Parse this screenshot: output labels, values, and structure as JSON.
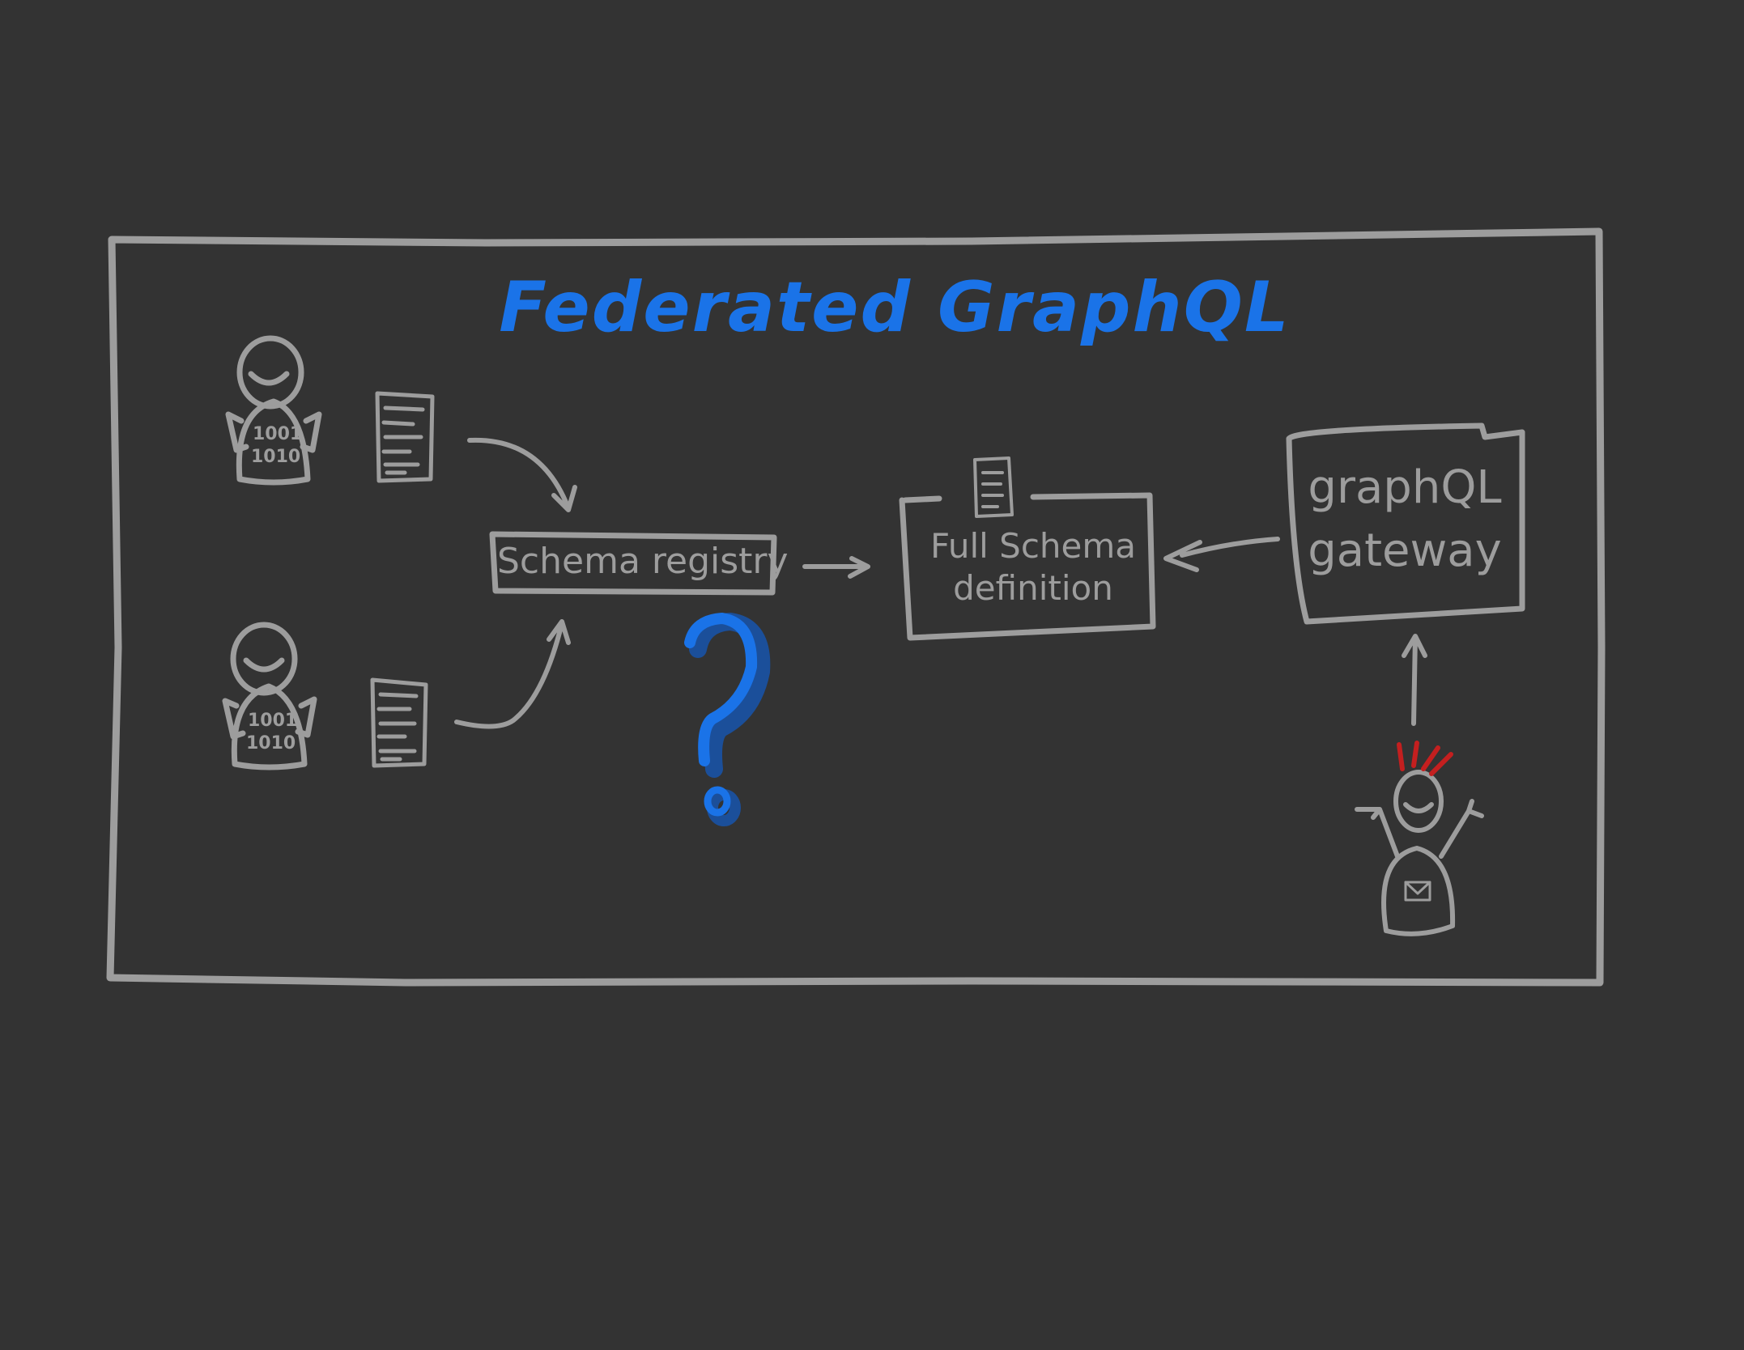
{
  "title": "Federated GraphQL",
  "colors": {
    "background": "#333333",
    "sketch": "#9d9d9d",
    "accent": "#1a73e8",
    "alert": "#c41f1f"
  },
  "developers": [
    {
      "bits_line1": "1001",
      "bits_line2": "1010"
    },
    {
      "bits_line1": "1001",
      "bits_line2": "1010"
    }
  ],
  "registry": {
    "label": "Schema registry"
  },
  "full_schema": {
    "line1": "Full Schema",
    "line2": "definition"
  },
  "gateway": {
    "line1": "graphQL",
    "line2": "gateway"
  },
  "question": {
    "glyph": "?"
  },
  "icons": [
    "smiley-developer-icon",
    "document-icon",
    "question-mark-icon",
    "envelope-icon",
    "excited-client-icon"
  ]
}
